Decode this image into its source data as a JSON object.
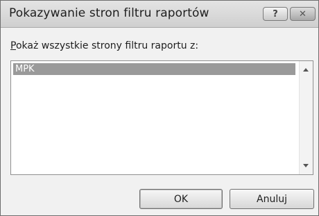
{
  "dialog": {
    "title": "Pokazywanie stron filtru raportów",
    "help_button": "?",
    "close_button": "✕"
  },
  "prompt": {
    "accel": "P",
    "rest": "okaż wszystkie strony filtru raportu z:"
  },
  "list": {
    "items": [
      "MPK"
    ],
    "selected_index": 0
  },
  "buttons": {
    "ok": "OK",
    "cancel": "Anuluj"
  }
}
